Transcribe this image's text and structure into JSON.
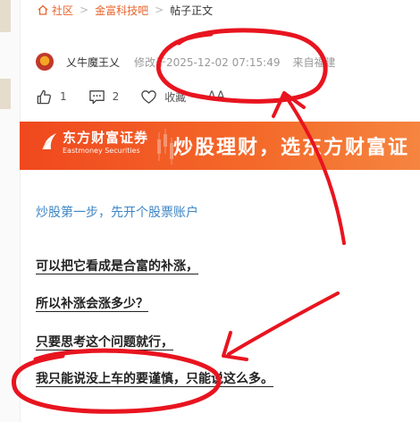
{
  "breadcrumb": {
    "items": [
      "社区",
      "金富科技吧",
      "帖子正文"
    ],
    "separator": ">"
  },
  "author": {
    "name": "乂牛魔王乂",
    "modified": "修改于2025-12-02 07:15:49",
    "source": "来自福建"
  },
  "actions": {
    "like_count": "1",
    "comment_count": "2",
    "favorite_label": "收藏",
    "font_label": "AA"
  },
  "banner": {
    "brand_cn": "东方财富证券",
    "brand_en": "Eastmoney Securities",
    "slogan": "炒股理财，选东方财富证"
  },
  "ad_link": "炒股第一步，先开个股票账户",
  "post": {
    "paragraphs": [
      "可以把它看成是合富的补涨，",
      "所以补涨会涨多少？",
      "只要思考这个问题就行，",
      "我只能说没上车的要谨慎，只能说这么多。"
    ]
  },
  "colors": {
    "accent": "#e8632a",
    "banner_orange": "#f0481e",
    "link_blue": "#3f86c6",
    "annotation_red": "#e8141f"
  }
}
